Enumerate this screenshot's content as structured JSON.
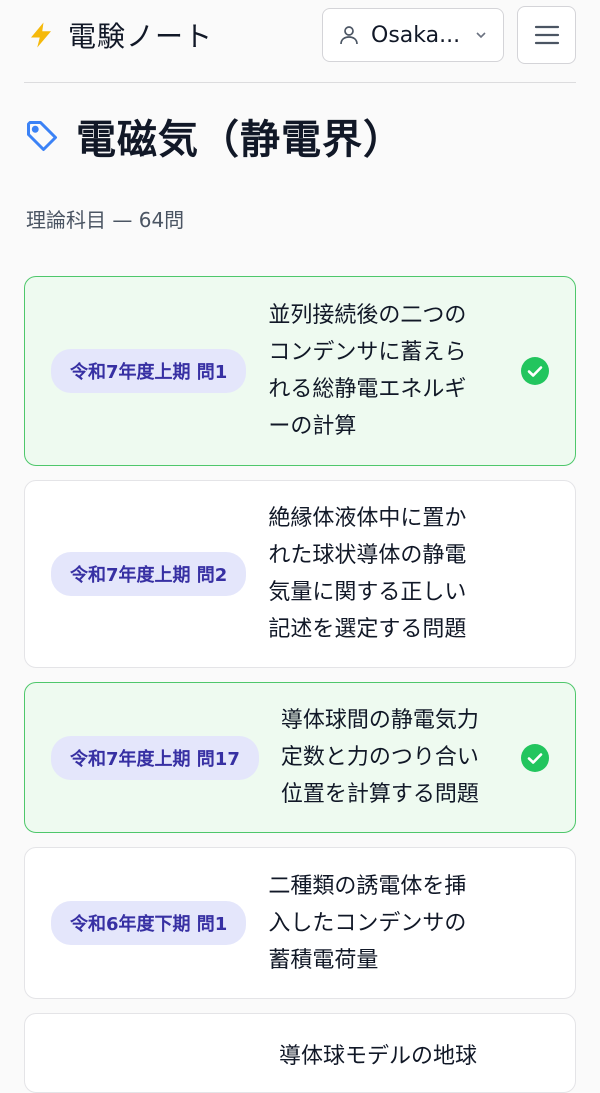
{
  "header": {
    "brand_name": "電験ノート",
    "user_label": "Osaka...",
    "bolt_icon": "lightning-bolt-icon",
    "accent_color": "#f5b90b"
  },
  "page": {
    "title": "電磁気（静電界）",
    "subtitle": "理論科目 — 64問",
    "tag_color": "#3b82f6"
  },
  "questions": [
    {
      "badge": "令和7年度上期 問1",
      "text": "並列接続後の二つのコンデンサに蓄えられる総静電エネルギーの計算",
      "done": true
    },
    {
      "badge": "令和7年度上期 問2",
      "text": "絶縁体液体中に置かれた球状導体の静電気量に関する正しい記述を選定する問題",
      "done": false
    },
    {
      "badge": "令和7年度上期 問17",
      "text": "導体球間の静電気力定数と力のつり合い位置を計算する問題",
      "done": true
    },
    {
      "badge": "令和6年度下期 問1",
      "text": "二種類の誘電体を挿入したコンデンサの蓄積電荷量",
      "done": false
    },
    {
      "badge": "",
      "text": "導体球モデルの地球",
      "done": false
    }
  ],
  "colors": {
    "done_bg": "#eefaf0",
    "done_border": "#4ec76b",
    "check": "#22c55e",
    "badge_bg": "#e4e6fb",
    "badge_text": "#3730a3"
  }
}
